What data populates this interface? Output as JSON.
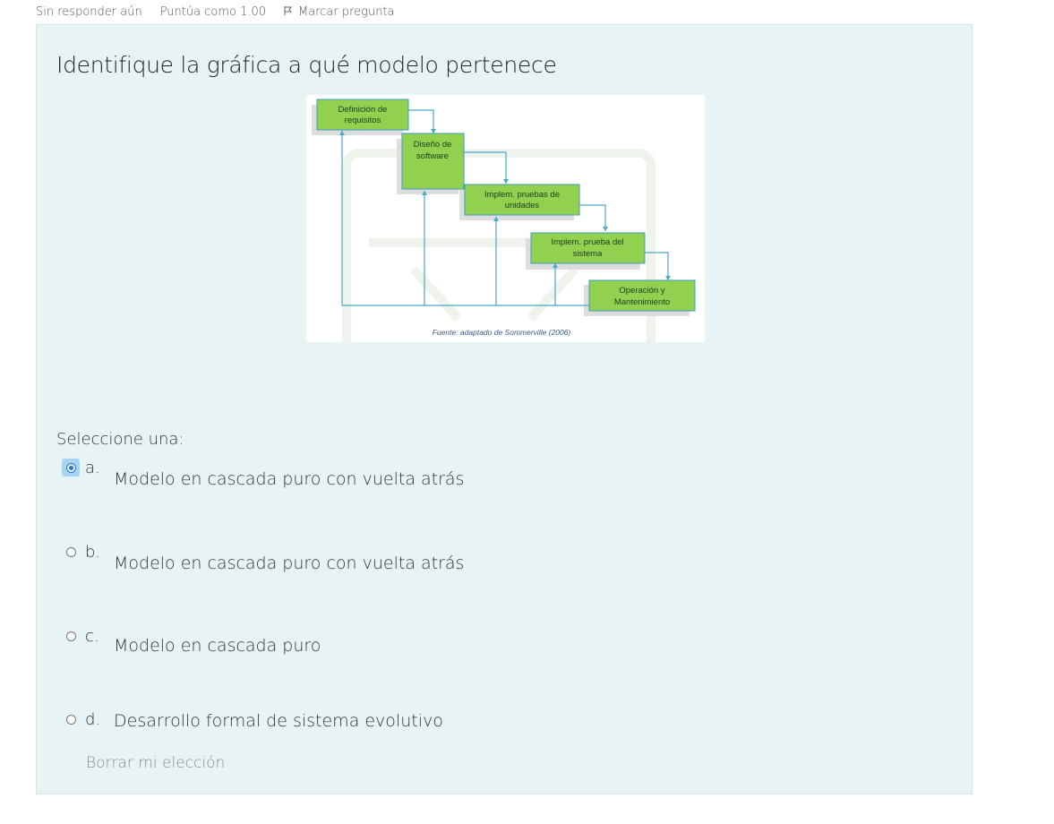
{
  "info": {
    "status": "Sin responder aún",
    "score": "Puntúa como 1.00",
    "flag_label": "Marcar pregunta"
  },
  "question": {
    "text": "Identifique la gráfica a qué modelo pertenece"
  },
  "diagram": {
    "boxes": [
      {
        "line1": "Definición de",
        "line2": "requisitos"
      },
      {
        "line1": "Diseño de",
        "line2": "software"
      },
      {
        "line1": "Implem. pruebas de",
        "line2": "unidades"
      },
      {
        "line1": "Implem. prueba del",
        "line2": "sistema"
      },
      {
        "line1": "Operación y",
        "line2": "Mantenimiento"
      }
    ],
    "caption": "Fuente: adaptado de Sommerville (2006)",
    "box_color": "#92d050",
    "line_color": "#4aa8c8"
  },
  "answer": {
    "prompt": "Seleccione una:",
    "options": [
      {
        "letter": "a.",
        "text": "Modelo en cascada puro con vuelta atrás",
        "selected": true
      },
      {
        "letter": "b.",
        "text": "Modelo en cascada puro con vuelta atrás",
        "selected": false
      },
      {
        "letter": "c.",
        "text": "Modelo en cascada puro",
        "selected": false
      },
      {
        "letter": "d.",
        "text": "Desarrollo formal de sistema evolutivo",
        "selected": false
      }
    ],
    "clear_label": "Borrar mi elección"
  }
}
